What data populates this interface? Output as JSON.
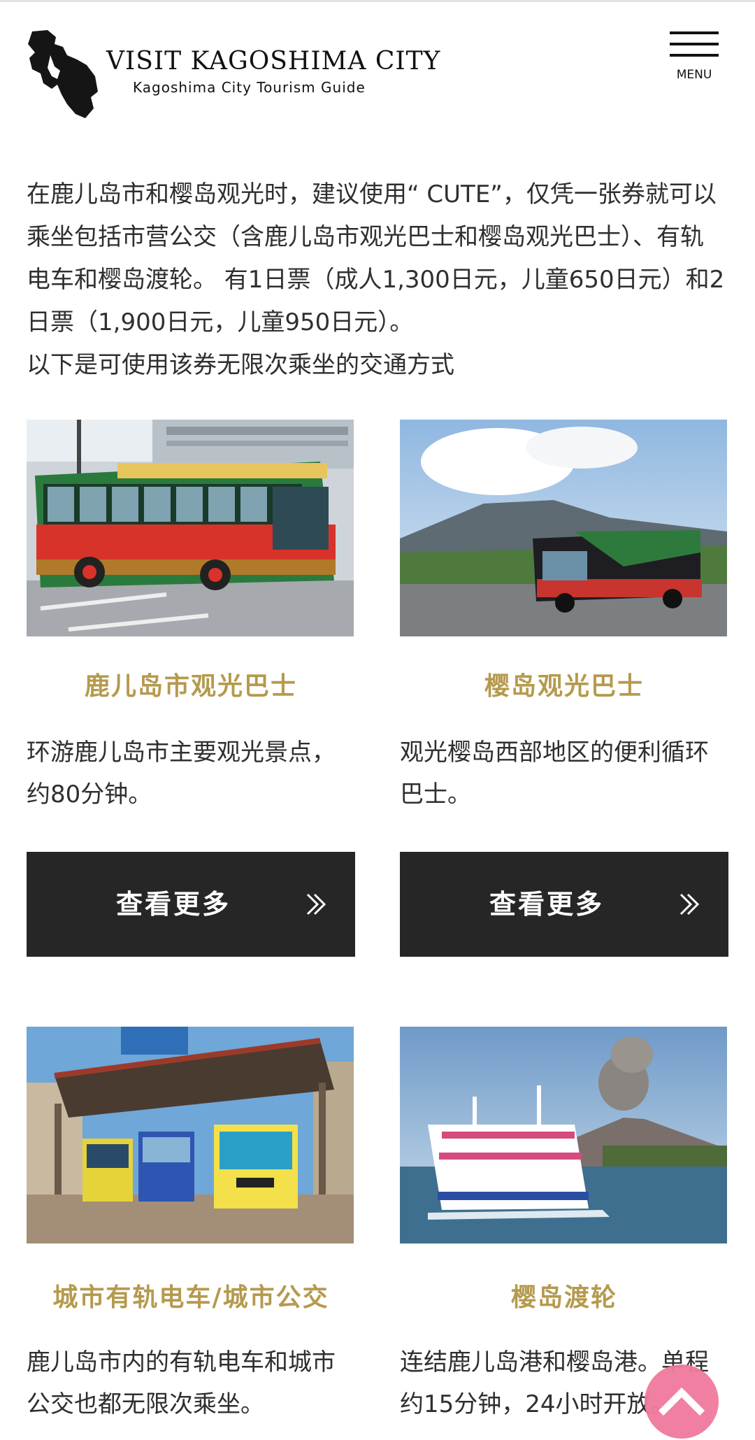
{
  "header": {
    "logo_title": "VISIT KAGOSHIMA CITY",
    "logo_subtitle": "Kagoshima City Tourism Guide",
    "menu_label": "MENU"
  },
  "intro": {
    "paragraph": "在鹿儿岛市和樱岛观光时，建议使用“ CUTE”，仅凭一张券就可以乘坐包括市营公交（含鹿儿岛市观光巴士和樱岛观光巴士）、有轨电车和樱岛渡轮。 有1日票（成人1,300日元，儿童650日元）和2日票（1,900日元，儿童950日元）。",
    "lead": "以下是可使用该券无限次乘坐的交通方式"
  },
  "cards": [
    {
      "title": "鹿儿岛市观光巴士",
      "description": "环游鹿儿岛市主要观光景点，约80分钟。",
      "button_label": "查看更多",
      "photo": "cityview-bus-photo"
    },
    {
      "title": "樱岛观光巴士",
      "description": "观光樱岛西部地区的便利循环巴士。",
      "button_label": "查看更多",
      "photo": "sakurajima-bus-photo"
    },
    {
      "title": "城市有轨电车/城市公交",
      "description": "鹿儿岛市内的有轨电车和城市公交也都无限次乘坐。",
      "photo": "city-tram-photo"
    },
    {
      "title": "樱岛渡轮",
      "description": "连结鹿儿岛港和樱岛港。单程约15分钟，24小时开放。",
      "photo": "sakurajima-ferry-photo"
    }
  ],
  "colors": {
    "title_gold": "#b59a4e",
    "button_dark": "#262626",
    "pagetop_pink": "#f0799c"
  },
  "icons": {
    "menu": "hamburger-icon",
    "more": "double-chevron-right-icon",
    "page_top": "chevron-up-icon"
  }
}
